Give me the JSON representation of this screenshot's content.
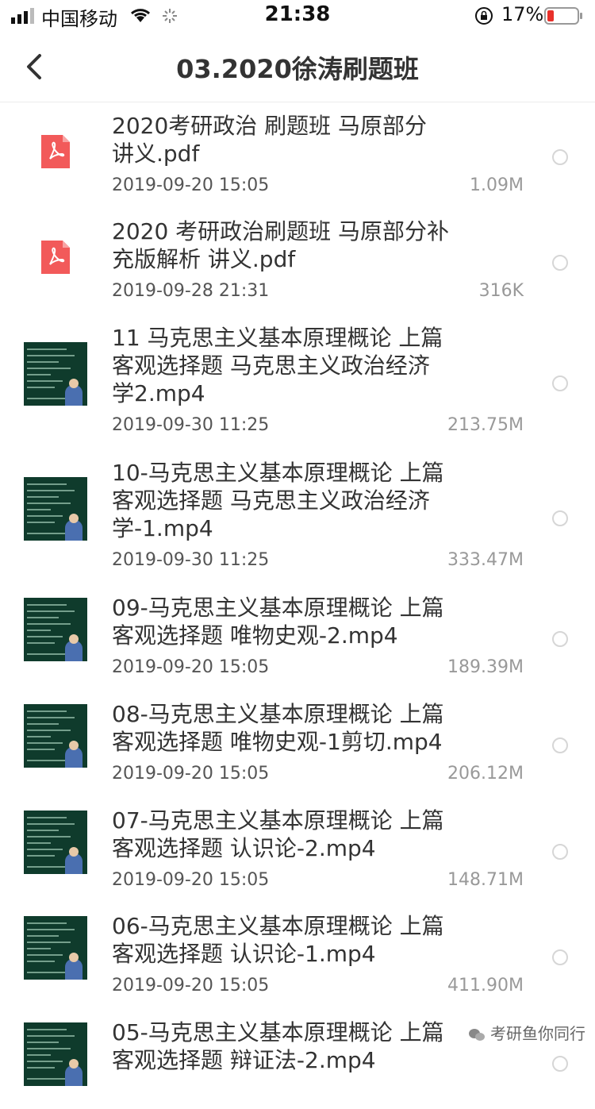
{
  "status": {
    "carrier": "中国移动",
    "time": "21:38",
    "battery": "17%"
  },
  "nav": {
    "title": "03.2020徐涛刷题班"
  },
  "files": [
    {
      "type": "pdf",
      "name_lines": [
        "2020考研政治 刷题班 马原部分",
        "讲义.pdf"
      ],
      "date": "2019-09-20 15:05",
      "size": "1.09M"
    },
    {
      "type": "pdf",
      "name_lines": [
        "2020 考研政治刷题班 马原部分补",
        "充版解析 讲义.pdf"
      ],
      "date": "2019-09-28 21:31",
      "size": "316K"
    },
    {
      "type": "video",
      "name_lines": [
        "11 马克思主义基本原理概论 上篇",
        "客观选择题 马克思主义政治经济",
        "学2.mp4"
      ],
      "date": "2019-09-30 11:25",
      "size": "213.75M"
    },
    {
      "type": "video",
      "name_lines": [
        "10-马克思主义基本原理概论 上篇",
        "客观选择题 马克思主义政治经济",
        "学-1.mp4"
      ],
      "date": "2019-09-30 11:25",
      "size": "333.47M"
    },
    {
      "type": "video",
      "name_lines": [
        "09-马克思主义基本原理概论 上篇",
        "客观选择题 唯物史观-2.mp4"
      ],
      "date": "2019-09-20 15:05",
      "size": "189.39M"
    },
    {
      "type": "video",
      "name_lines": [
        "08-马克思主义基本原理概论 上篇",
        "客观选择题 唯物史观-1剪切.mp4"
      ],
      "date": "2019-09-20 15:05",
      "size": "206.12M"
    },
    {
      "type": "video",
      "name_lines": [
        "07-马克思主义基本原理概论 上篇",
        "客观选择题 认识论-2.mp4"
      ],
      "date": "2019-09-20 15:05",
      "size": "148.71M"
    },
    {
      "type": "video",
      "name_lines": [
        "06-马克思主义基本原理概论 上篇",
        "客观选择题 认识论-1.mp4"
      ],
      "date": "2019-09-20 15:05",
      "size": "411.90M"
    },
    {
      "type": "video",
      "name_lines": [
        "05-马克思主义基本原理概论 上篇",
        "客观选择题 辩证法-2.mp4"
      ],
      "date": "",
      "size": ""
    }
  ],
  "watermark": "考研鱼你同行",
  "colors": {
    "pdf_red": "#f25a5a",
    "video_bg": "#0f3b2c"
  }
}
